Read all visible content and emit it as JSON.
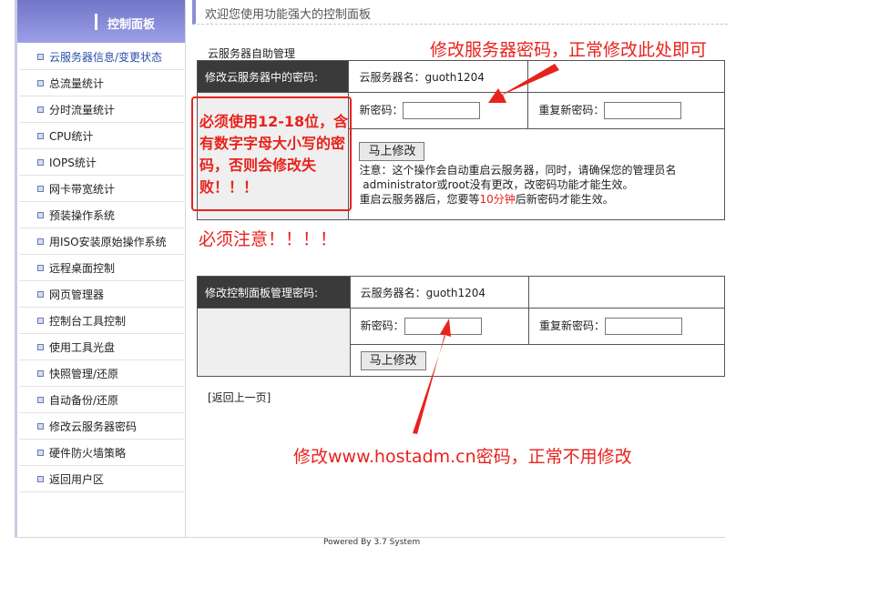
{
  "sidebar": {
    "title": "控制面板",
    "items": [
      {
        "label": "云服务器信息/变更状态",
        "active": true
      },
      {
        "label": "总流量统计"
      },
      {
        "label": "分时流量统计"
      },
      {
        "label": "CPU统计"
      },
      {
        "label": "IOPS统计"
      },
      {
        "label": "网卡带宽统计"
      },
      {
        "label": "预装操作系统"
      },
      {
        "label": "用ISO安装原始操作系统"
      },
      {
        "label": "远程桌面控制"
      },
      {
        "label": "网页管理器"
      },
      {
        "label": "控制台工具控制"
      },
      {
        "label": "使用工具光盘"
      },
      {
        "label": "快照管理/还原"
      },
      {
        "label": "自动备份/还原"
      },
      {
        "label": "修改云服务器密码"
      },
      {
        "label": "硬件防火墙策略"
      },
      {
        "label": "返回用户区"
      }
    ]
  },
  "header": {
    "welcome": "欢迎您使用功能强大的控制面板"
  },
  "section1": {
    "title": "云服务器自助管理",
    "row_label": "修改云服务器中的密码:",
    "server_name": "云服务器名：guoth1204",
    "new_password_label": "新密码：",
    "repeat_password_label": "重复新密码：",
    "submit_label": "马上修改",
    "note_line1": "注意：这个操作会自动重启云服务器，同时，请确保您的管理员名",
    "note_line2": " administrator或root没有更改，改密码功能才能生效。",
    "note_line3_a": "重启云服务器后，您要等",
    "note_line3_b": "10分钟",
    "note_line3_c": "后新密码才能生效。"
  },
  "section2": {
    "row_label": "修改控制面板管理密码:",
    "server_name": "云服务器名：guoth1204",
    "new_password_label": "新密码：",
    "repeat_password_label": "重复新密码：",
    "submit_label": "马上修改"
  },
  "back_link": "[返回上一页]",
  "footer": "Powered By 3.7 System",
  "annotations": {
    "top": "修改服务器密码，正常修改此处即可",
    "box": "必须使用12-18位，含有数字字母大小写的密码，否则会修改失败！！！",
    "attention": "必须注意！！！！",
    "bottom": "修改www.hostadm.cn密码，正常不用修改",
    "color": "#e8221c"
  }
}
